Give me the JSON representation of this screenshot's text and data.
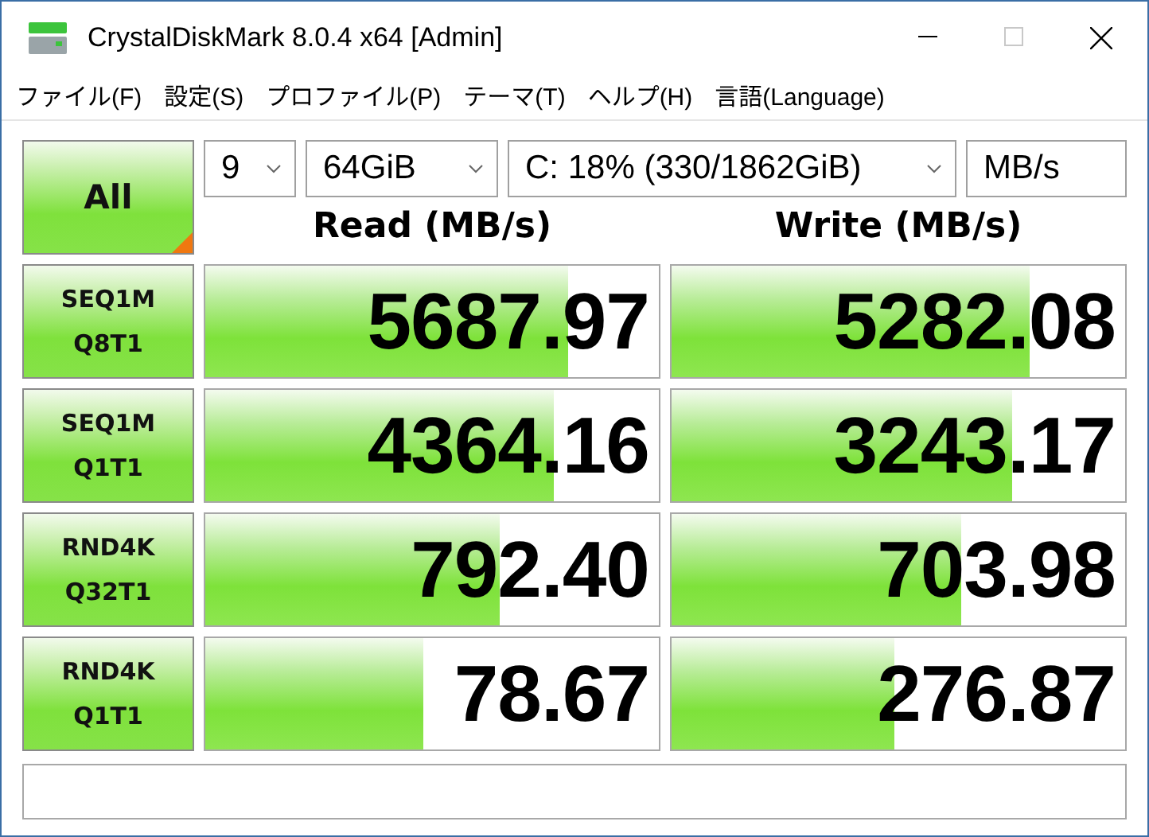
{
  "window": {
    "title": "CrystalDiskMark 8.0.4 x64 [Admin]",
    "maximize_disabled": true
  },
  "menu": [
    "ファイル(F)",
    "設定(S)",
    "プロファイル(P)",
    "テーマ(T)",
    "ヘルプ(H)",
    "言語(Language)"
  ],
  "controls": {
    "all_button": "All",
    "count": "9",
    "size": "64GiB",
    "drive": "C: 18% (330/1862GiB)",
    "unit": "MB/s"
  },
  "columns": [
    "Read (MB/s)",
    "Write (MB/s)"
  ],
  "tests": [
    {
      "name": "SEQ1M",
      "params": "Q8T1",
      "read": {
        "value": "5687.97",
        "level": 0.8
      },
      "write": {
        "value": "5282.08",
        "level": 0.79
      }
    },
    {
      "name": "SEQ1M",
      "params": "Q1T1",
      "read": {
        "value": "4364.16",
        "level": 0.77
      },
      "write": {
        "value": "3243.17",
        "level": 0.75
      }
    },
    {
      "name": "RND4K",
      "params": "Q32T1",
      "read": {
        "value": "792.40",
        "level": 0.65
      },
      "write": {
        "value": "703.98",
        "level": 0.64
      }
    },
    {
      "name": "RND4K",
      "params": "Q1T1",
      "read": {
        "value": "78.67",
        "level": 0.48
      },
      "write": {
        "value": "276.87",
        "level": 0.49
      }
    }
  ]
}
